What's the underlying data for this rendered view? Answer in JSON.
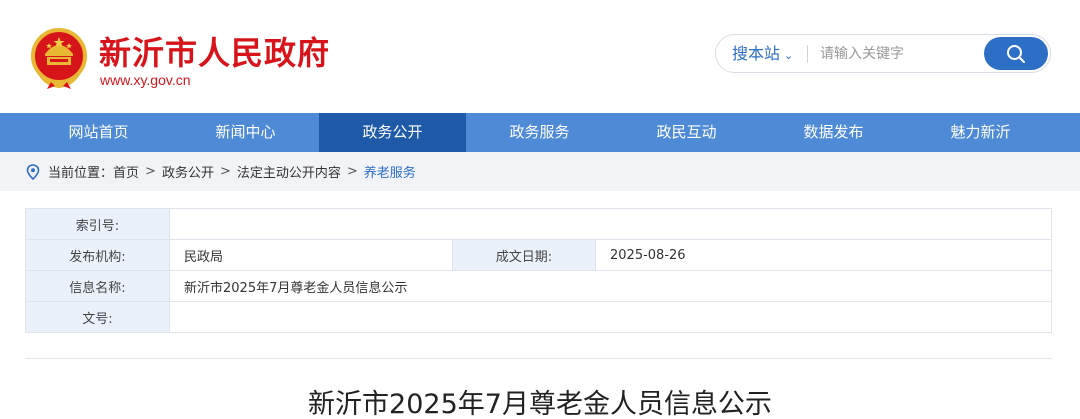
{
  "header": {
    "site_title": "新沂市人民政府",
    "site_url": "www.xy.gov.cn",
    "brand_color": "#d7141a"
  },
  "search": {
    "scope_label": "搜本站",
    "placeholder": "请输入关键字",
    "value": "",
    "accent_color": "#2d6fc6"
  },
  "nav": {
    "items": [
      {
        "label": "网站首页"
      },
      {
        "label": "新闻中心"
      },
      {
        "label": "政务公开"
      },
      {
        "label": "政务服务"
      },
      {
        "label": "政民互动"
      },
      {
        "label": "数据发布"
      },
      {
        "label": "魅力新沂"
      }
    ],
    "active_index": 2,
    "bg_color": "#4e8ad6",
    "active_color": "#1f5aa8"
  },
  "breadcrumb": {
    "prefix": "当前位置：",
    "items": [
      {
        "label": "首页"
      },
      {
        "label": "政务公开"
      },
      {
        "label": "法定主动公开内容"
      },
      {
        "label": "养老服务"
      }
    ],
    "separator": ">"
  },
  "info": {
    "index_label": "索引号:",
    "index_value": "",
    "publisher_label": "发布机构:",
    "publisher_value": "民政局",
    "date_label": "成文日期:",
    "date_value": "2025-08-26",
    "name_label": "信息名称:",
    "name_value": "新沂市2025年7月尊老金人员信息公示",
    "docno_label": "文号:",
    "docno_value": ""
  },
  "article": {
    "title": "新沂市2025年7月尊老金人员信息公示"
  }
}
